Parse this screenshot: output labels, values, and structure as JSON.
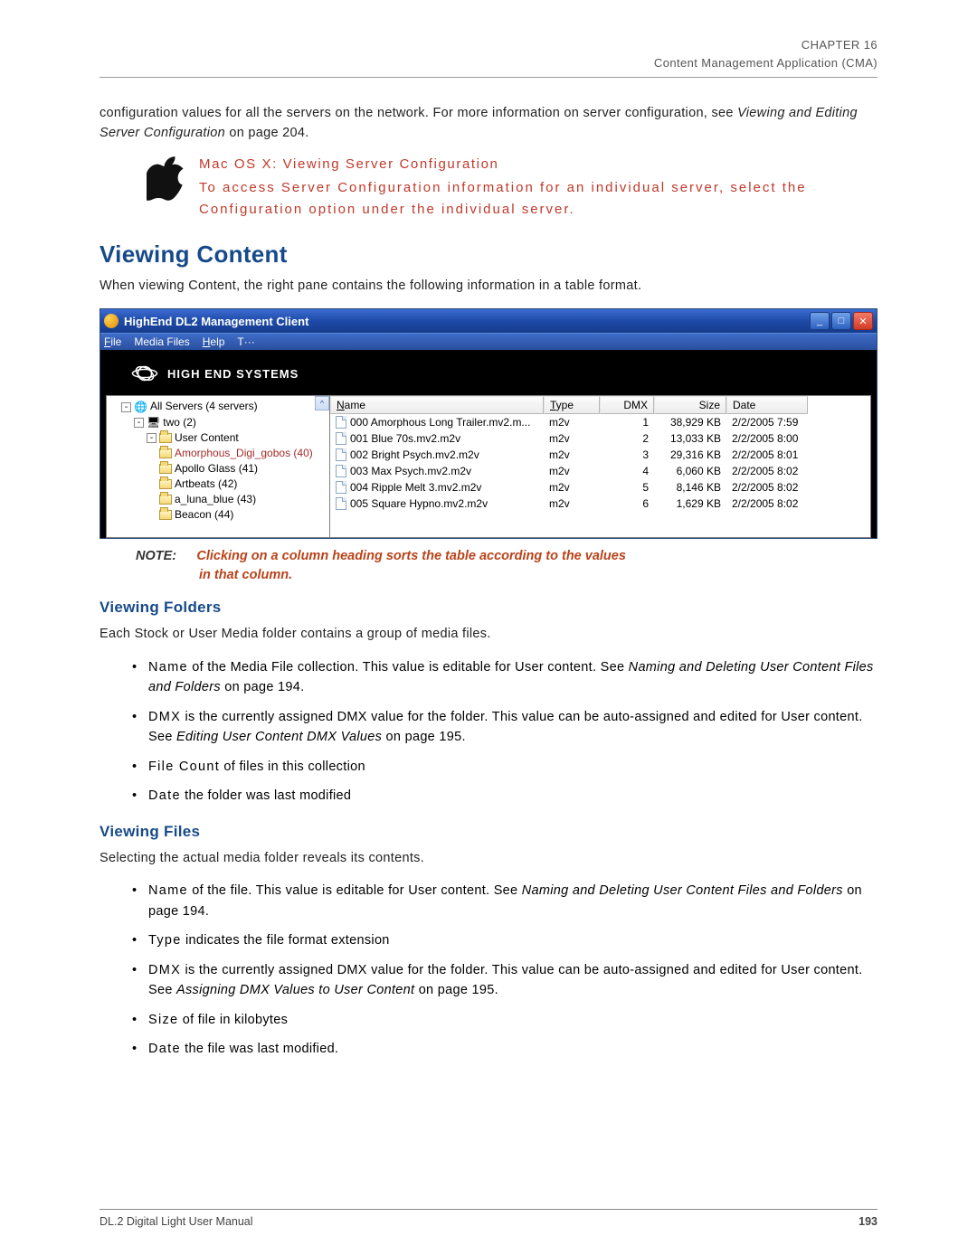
{
  "header": {
    "chapter": "CHAPTER 16",
    "title": "Content Management Application (CMA)"
  },
  "intro_para": "configuration values for all the servers on the network. For more information on server configuration, see ",
  "intro_link": "Viewing and Editing Server Configuration",
  "intro_tail": " on page 204.",
  "mac": {
    "title": "Mac OS X: Viewing Server Configuration",
    "desc": "To access Server Configuration information for an individual server, select the Configuration option under the individual server."
  },
  "section_title": "Viewing Content",
  "section_para": "When viewing Content, the right pane contains the following information in a table format.",
  "window": {
    "title": "HighEnd DL2 Management Client",
    "menus": [
      "File",
      "Media Files",
      "Help",
      "T···"
    ],
    "brand": "HIGH END SYSTEMS",
    "tree": {
      "root": "All Servers (4 servers)",
      "l1": "two (2)",
      "l2": "User Content",
      "items": [
        "Amorphous_Digi_gobos (40)",
        "Apollo Glass (41)",
        "Artbeats (42)",
        "a_luna_blue (43)",
        "Beacon (44)"
      ]
    },
    "columns": [
      "Name",
      "Type",
      "DMX",
      "Size",
      "Date"
    ],
    "rows": [
      {
        "name": "000 Amorphous Long Trailer.mv2.m...",
        "type": "m2v",
        "dmx": "1",
        "size": "38,929 KB",
        "date": "2/2/2005 7:59"
      },
      {
        "name": "001 Blue 70s.mv2.m2v",
        "type": "m2v",
        "dmx": "2",
        "size": "13,033 KB",
        "date": "2/2/2005 8:00"
      },
      {
        "name": "002 Bright Psych.mv2.m2v",
        "type": "m2v",
        "dmx": "3",
        "size": "29,316 KB",
        "date": "2/2/2005 8:01"
      },
      {
        "name": "003 Max Psych.mv2.m2v",
        "type": "m2v",
        "dmx": "4",
        "size": "6,060 KB",
        "date": "2/2/2005 8:02"
      },
      {
        "name": "004 Ripple Melt 3.mv2.m2v",
        "type": "m2v",
        "dmx": "5",
        "size": "8,146 KB",
        "date": "2/2/2005 8:02"
      },
      {
        "name": "005 Square Hypno.mv2.m2v",
        "type": "m2v",
        "dmx": "6",
        "size": "1,629 KB",
        "date": "2/2/2005 8:02"
      }
    ]
  },
  "note": {
    "label": "NOTE:",
    "line1": "Clicking on a column heading sorts the table according to the values",
    "line2": "in that column."
  },
  "folders": {
    "heading": "Viewing Folders",
    "para": "Each Stock or User Media folder contains a group of media files.",
    "bullets": [
      {
        "term": "Name",
        "rest": " of the Media File collection. This value is editable for User content. See ",
        "ital": "Naming and Deleting User Content Files and Folders",
        "tail": " on page 194."
      },
      {
        "term": "DMX",
        "rest": " is the currently assigned DMX value for the folder. This value can be auto-assigned and edited for User content. See ",
        "ital": "Editing User Content DMX Values",
        "tail": " on page 195."
      },
      {
        "term": "File Count",
        "rest": " of files in this collection",
        "ital": "",
        "tail": ""
      },
      {
        "term": "Date",
        "rest": " the folder was last modified",
        "ital": "",
        "tail": ""
      }
    ]
  },
  "files": {
    "heading": "Viewing Files",
    "para": "Selecting the actual media folder reveals its contents.",
    "bullets": [
      {
        "term": "Name",
        "rest": " of the file. This value is editable for User content. See ",
        "ital": "Naming and Deleting User Content Files and Folders",
        "tail": " on page 194."
      },
      {
        "term": "Type",
        "rest": " indicates the file format extension",
        "ital": "",
        "tail": ""
      },
      {
        "term": "DMX",
        "rest": " is the currently assigned DMX value for the folder. This value can be auto-assigned and edited for User content. See ",
        "ital": "Assigning DMX Values to User Content",
        "tail": " on page 195."
      },
      {
        "term": "Size",
        "rest": " of file in kilobytes",
        "ital": "",
        "tail": ""
      },
      {
        "term": "Date",
        "rest": " the file was last modified.",
        "ital": "",
        "tail": ""
      }
    ]
  },
  "footer": {
    "left": "DL.2 Digital Light User Manual",
    "page": "193"
  }
}
